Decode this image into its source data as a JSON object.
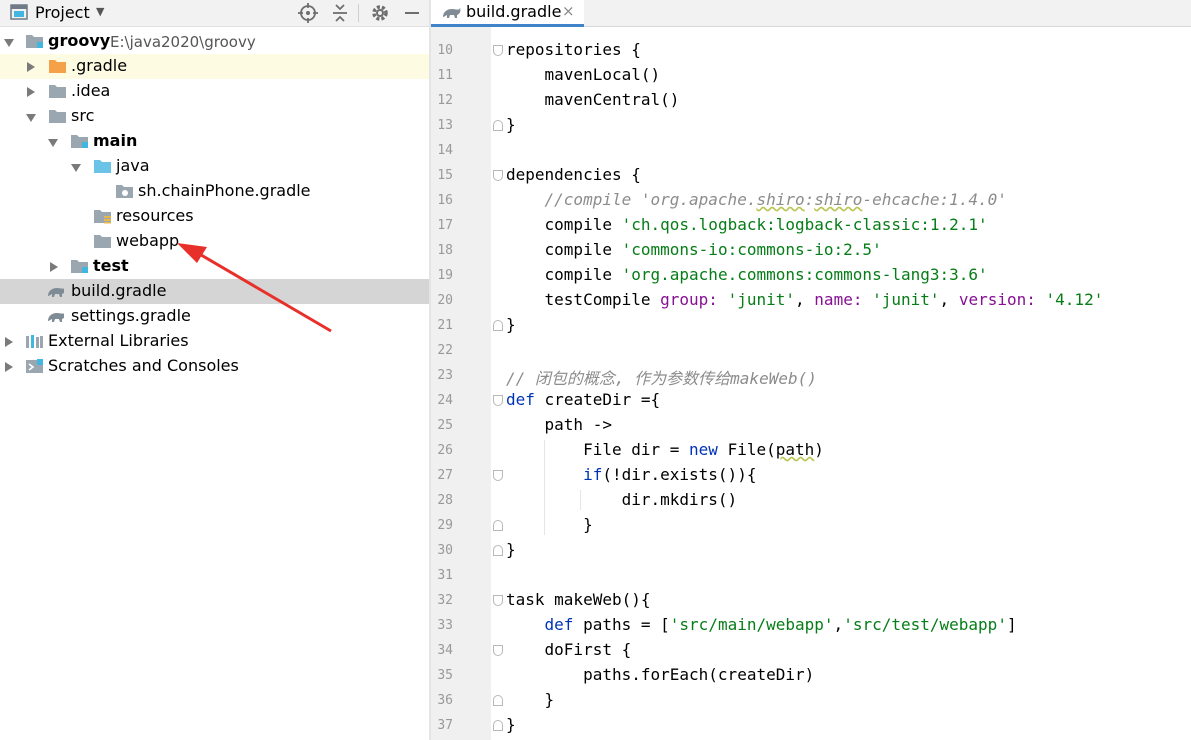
{
  "project_panel": {
    "title": "Project",
    "icons": [
      "locate-icon",
      "collapse-all-icon",
      "gear-icon",
      "minimize-icon"
    ],
    "tree": [
      {
        "label": "groovy",
        "path": "E:\\java2020\\groovy",
        "bold": true,
        "icon": "module-folder-icon"
      },
      {
        "label": ".gradle",
        "icon": "orange-folder-icon"
      },
      {
        "label": ".idea",
        "icon": "folder-icon"
      },
      {
        "label": "src",
        "icon": "folder-icon"
      },
      {
        "label": "main",
        "bold": true,
        "icon": "module-folder-icon"
      },
      {
        "label": "java",
        "icon": "source-folder-icon"
      },
      {
        "label": "sh.chainPhone.gradle",
        "icon": "package-icon"
      },
      {
        "label": "resources",
        "icon": "resources-folder-icon"
      },
      {
        "label": "webapp",
        "icon": "folder-icon"
      },
      {
        "label": "test",
        "bold": true,
        "icon": "module-folder-icon"
      },
      {
        "label": "build.gradle",
        "icon": "gradle-icon",
        "selected": true
      },
      {
        "label": "settings.gradle",
        "icon": "gradle-icon"
      },
      {
        "label": "External Libraries",
        "icon": "library-icon"
      },
      {
        "label": "Scratches and Consoles",
        "icon": "scratches-icon"
      }
    ]
  },
  "editor": {
    "tab_label": "build.gradle",
    "tab_close": "×",
    "line_numbers": [
      "10",
      "11",
      "12",
      "13",
      "14",
      "15",
      "16",
      "17",
      "18",
      "19",
      "20",
      "21",
      "22",
      "23",
      "24",
      "25",
      "26",
      "27",
      "28",
      "29",
      "30",
      "31",
      "32",
      "33",
      "34",
      "35",
      "36",
      "37"
    ],
    "code": {
      "repositories": "repositories {",
      "mavenLocal": "mavenLocal()",
      "mavenCentral": "mavenCentral()",
      "close": "}",
      "dependencies": "dependencies {",
      "comment_compile_pre": "//compile 'org.apache.",
      "comment_compile_shiro": "shiro",
      "comment_compile_colon": ":",
      "comment_compile_shiro2": "shiro",
      "comment_compile_post": "-ehcache:1.4.0'",
      "compile_kw": "compile",
      "str_logback": "'ch.qos.logback:logback-classic:1.2.1'",
      "str_commons_io": "'commons-io:commons-io:2.5'",
      "str_commons_lang": "'org.apache.commons:commons-lang3:3.6'",
      "testCompile": "testCompile",
      "group_key": "group:",
      "group_val": "'junit'",
      "name_key": "name:",
      "name_val": "'junit'",
      "version_key": "version:",
      "version_val": "'4.12'",
      "comma": ",",
      "comment_closure": "// 闭包的概念, 作为参数传给makeWeb()",
      "def_kw": "def",
      "createDir": "createDir ={",
      "path_arrow": "path ->",
      "file_dir": "File dir = ",
      "new_kw": "new",
      "file_path_pre": "File(",
      "file_path_param": "path",
      "file_path_post": ")",
      "if_kw": "if",
      "if_cond": "(!dir.exists()){",
      "mkdirs": "dir.mkdirs()",
      "task_makeWeb": "task makeWeb(){",
      "paths_pre": "paths = [",
      "str_src_main": "'src/main/webapp'",
      "str_src_test": "'src/test/webapp'",
      "bracket_close": "]",
      "doFirst": "doFirst {",
      "foreach": "paths.forEach(createDir)"
    }
  },
  "annotation": {
    "color": "#e8302a"
  }
}
